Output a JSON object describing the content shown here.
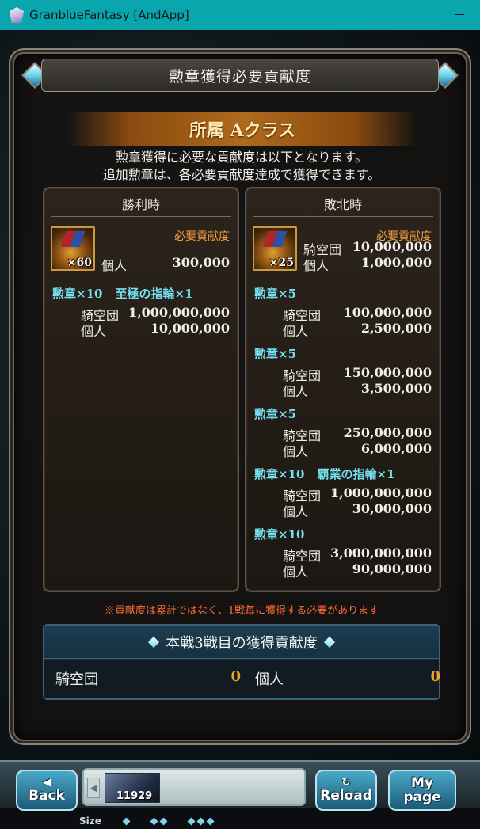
{
  "window": {
    "title": "GranblueFantasy [AndApp]"
  },
  "dialog": {
    "title": "勲章獲得必要貢献度",
    "class_label": "所属 Aクラス",
    "intro": [
      "勲章獲得に必要な貢献度は以下となります。",
      "追加勲章は、各必要貢献度達成で獲得できます。"
    ],
    "note": "※貢献度は累計ではなく、1戦毎に獲得する必要があります"
  },
  "win_panel": {
    "header": "勝利時",
    "medal_qty": "×60",
    "req_label": "必要貢献度",
    "base": [
      {
        "k": "個人",
        "v": "300,000"
      }
    ],
    "tiers": [
      {
        "reward": "勲章×10",
        "reward2": "至極の指輪×1",
        "rows": [
          {
            "k": "騎空団",
            "v": "1,000,000,000"
          },
          {
            "k": "個人",
            "v": "10,000,000"
          }
        ]
      }
    ]
  },
  "lose_panel": {
    "header": "敗北時",
    "medal_qty": "×25",
    "req_label": "必要貢献度",
    "base": [
      {
        "k": "騎空団",
        "v": "10,000,000"
      },
      {
        "k": "個人",
        "v": "1,000,000"
      }
    ],
    "tiers": [
      {
        "reward": "勲章×5",
        "reward2": "",
        "rows": [
          {
            "k": "騎空団",
            "v": "100,000,000"
          },
          {
            "k": "個人",
            "v": "2,500,000"
          }
        ]
      },
      {
        "reward": "勲章×5",
        "reward2": "",
        "rows": [
          {
            "k": "騎空団",
            "v": "150,000,000"
          },
          {
            "k": "個人",
            "v": "3,500,000"
          }
        ]
      },
      {
        "reward": "勲章×5",
        "reward2": "",
        "rows": [
          {
            "k": "騎空団",
            "v": "250,000,000"
          },
          {
            "k": "個人",
            "v": "6,000,000"
          }
        ]
      },
      {
        "reward": "勲章×10",
        "reward2": "覇業の指輪×1",
        "rows": [
          {
            "k": "騎空団",
            "v": "1,000,000,000"
          },
          {
            "k": "個人",
            "v": "30,000,000"
          }
        ]
      },
      {
        "reward": "勲章×10",
        "reward2": "",
        "rows": [
          {
            "k": "騎空団",
            "v": "3,000,000,000"
          },
          {
            "k": "個人",
            "v": "90,000,000"
          }
        ]
      }
    ]
  },
  "battle": {
    "title": "本戦3戦目の獲得貢献度",
    "crew_label": "騎空団",
    "crew_value": "0",
    "personal_label": "個人",
    "personal_value": "0"
  },
  "nav": {
    "back_label": "Back",
    "reload_label": "Reload",
    "mypage_label": [
      "My",
      "page"
    ],
    "thumb_number": "11929",
    "size_label": "Size"
  },
  "colors": {
    "accent_blue": "#74e0f0",
    "orange": "#f0a040",
    "titlebar": "#0aa6ad",
    "warning": "#ff6a33"
  },
  "icons": {
    "app": "app-icon",
    "gem": "diamond-gem-icon",
    "medal": "medal-icon",
    "back": "left-arrow-icon",
    "reload": "reload-icon"
  }
}
